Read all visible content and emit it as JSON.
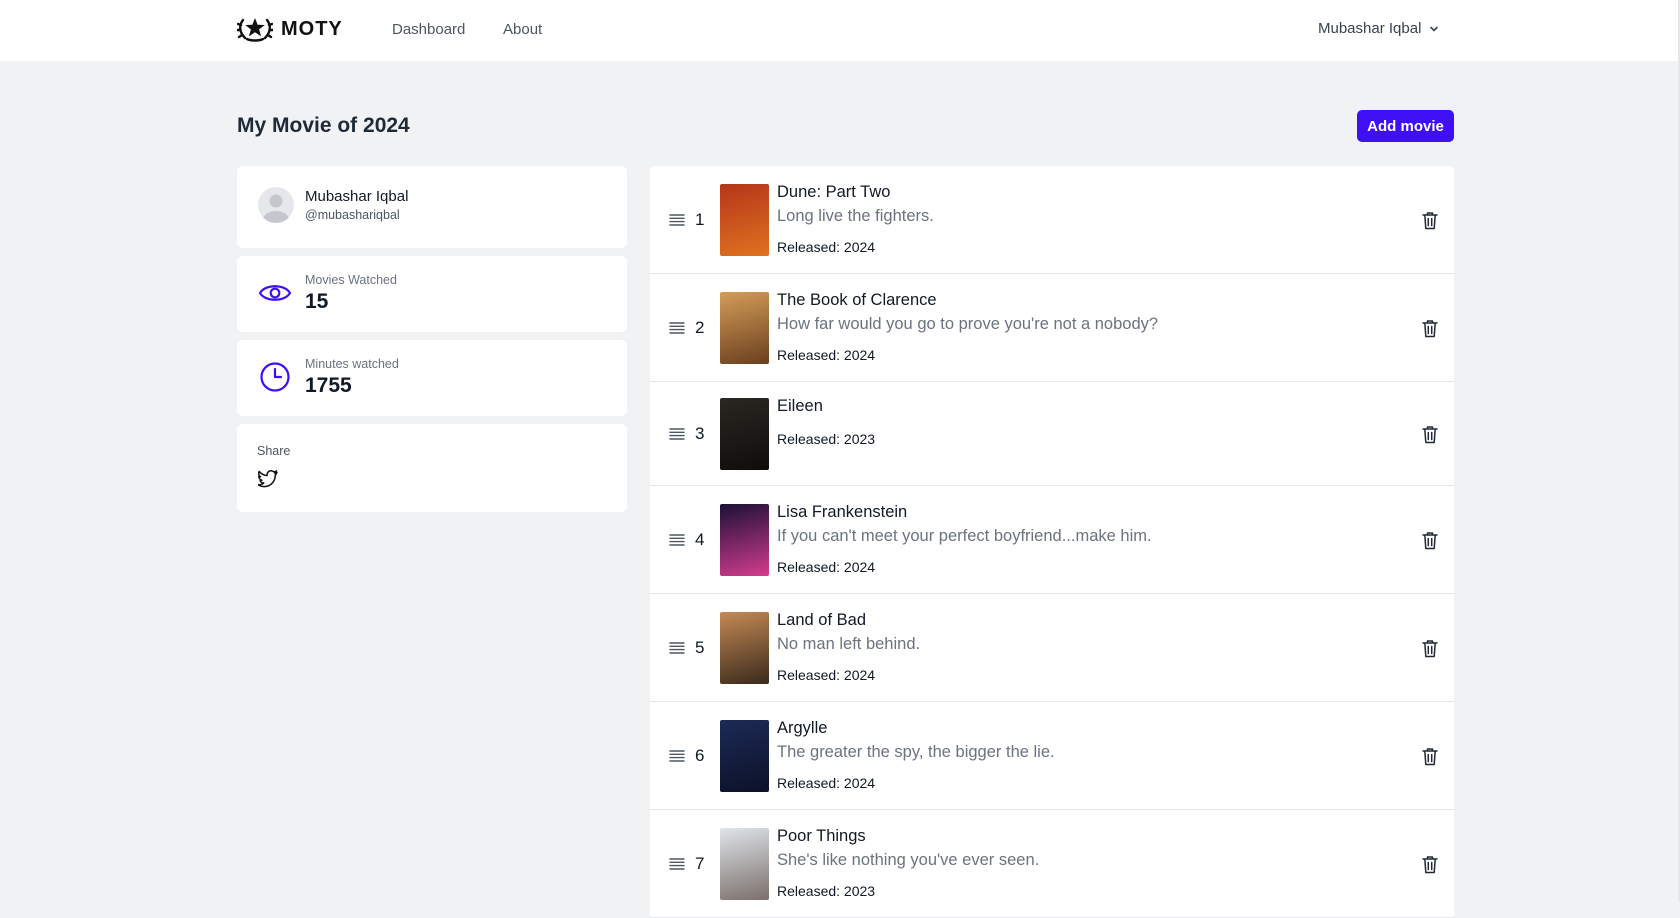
{
  "app": {
    "brand": "MOTY"
  },
  "nav": {
    "items": [
      "Dashboard",
      "About"
    ],
    "user": "Mubashar Iqbal"
  },
  "page": {
    "title": "My Movie of 2024",
    "add_button": "Add movie"
  },
  "profile": {
    "name": "Mubashar Iqbal",
    "handle": "@mubashariqbal"
  },
  "stats": {
    "movies_watched": {
      "label": "Movies Watched",
      "value": "15"
    },
    "minutes_watched": {
      "label": "Minutes watched",
      "value": "1755"
    }
  },
  "share": {
    "label": "Share"
  },
  "movies": [
    {
      "rank": "1",
      "title": "Dune: Part Two",
      "tagline": "Long live the fighters.",
      "released": "Released: 2024",
      "poster_colors": [
        "#b4361a",
        "#e0721f"
      ]
    },
    {
      "rank": "2",
      "title": "The Book of Clarence",
      "tagline": "How far would you go to prove you're not a nobody?",
      "released": "Released: 2024",
      "poster_colors": [
        "#d39d58",
        "#6b3f1e"
      ]
    },
    {
      "rank": "3",
      "title": "Eileen",
      "tagline": "",
      "released": "Released: 2023",
      "poster_colors": [
        "#2a2622",
        "#0f0d0b"
      ]
    },
    {
      "rank": "4",
      "title": "Lisa Frankenstein",
      "tagline": "If you can't meet your perfect boyfriend...make him.",
      "released": "Released: 2024",
      "poster_colors": [
        "#1c1035",
        "#d43c8e"
      ]
    },
    {
      "rank": "5",
      "title": "Land of Bad",
      "tagline": "No man left behind.",
      "released": "Released: 2024",
      "poster_colors": [
        "#c48a55",
        "#3a2a1c"
      ]
    },
    {
      "rank": "6",
      "title": "Argylle",
      "tagline": "The greater the spy, the bigger the lie.",
      "released": "Released: 2024",
      "poster_colors": [
        "#1c2a55",
        "#0c1128"
      ]
    },
    {
      "rank": "7",
      "title": "Poor Things",
      "tagline": "She's like nothing you've ever seen.",
      "released": "Released: 2023",
      "poster_colors": [
        "#dfe4ea",
        "#7a6f6a"
      ]
    }
  ]
}
